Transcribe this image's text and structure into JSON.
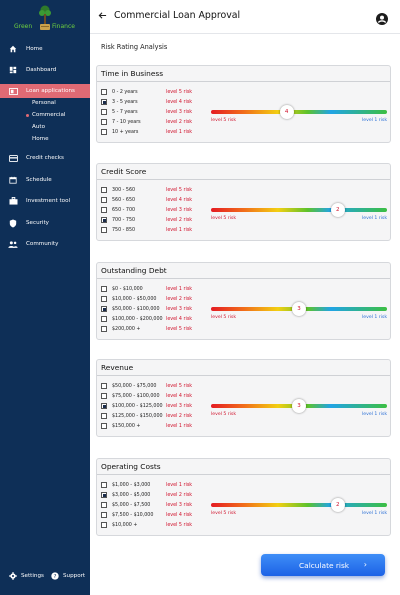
{
  "brand": {
    "word_left": "Green",
    "word_right": "Finance"
  },
  "sidebar": {
    "items": [
      {
        "label": "Home",
        "icon": "home-icon"
      },
      {
        "label": "Dashboard",
        "icon": "dashboard-icon"
      },
      {
        "label": "Loan applications",
        "icon": "card-icon",
        "active": true
      },
      {
        "label": "Credit checks",
        "icon": "credit-card-icon"
      },
      {
        "label": "Schedule",
        "icon": "calendar-icon"
      },
      {
        "label": "Investment tool",
        "icon": "briefcase-icon"
      },
      {
        "label": "Security",
        "icon": "shield-icon"
      },
      {
        "label": "Community",
        "icon": "people-icon"
      }
    ],
    "sub_items": [
      {
        "label": "Personal"
      },
      {
        "label": "Commercial",
        "active": true
      },
      {
        "label": "Auto"
      },
      {
        "label": "Home"
      }
    ],
    "footer": {
      "settings": "Settings",
      "support": "Support"
    }
  },
  "header": {
    "title": "Commercial Loan Approval"
  },
  "section": {
    "title": "Risk Rating Analysis"
  },
  "colors": {
    "accent": "#1c62e6",
    "sidebar": "#0e2f57",
    "active": "#e06a74",
    "risk_text": "#d0112b"
  },
  "criteria": [
    {
      "title": "Time in Business",
      "options": [
        {
          "label": "0 - 2 years",
          "risk": "level 5 risk",
          "checked": false
        },
        {
          "label": "3 - 5 years",
          "risk": "level 4 risk",
          "checked": true
        },
        {
          "label": "5 - 7 years",
          "risk": "level 3 risk",
          "checked": false
        },
        {
          "label": "7 - 10 years",
          "risk": "level 2 risk",
          "checked": false
        },
        {
          "label": "10 + years",
          "risk": "level 1 risk",
          "checked": false
        }
      ],
      "slider": {
        "value": 4,
        "position": 0.43,
        "low": "level 5 risk",
        "high": "level 1 risk"
      }
    },
    {
      "title": "Credit Score",
      "options": [
        {
          "label": "300 - 560",
          "risk": "level 5 risk",
          "checked": false
        },
        {
          "label": "560 - 650",
          "risk": "level 4 risk",
          "checked": false
        },
        {
          "label": "650 - 700",
          "risk": "level 3 risk",
          "checked": false
        },
        {
          "label": "700 - 750",
          "risk": "level 2 risk",
          "checked": true
        },
        {
          "label": "750 - 850",
          "risk": "level 1 risk",
          "checked": false
        }
      ],
      "slider": {
        "value": 2,
        "position": 0.72,
        "low": "level 5 risk",
        "high": "level 1 risk"
      }
    },
    {
      "title": "Outstanding Debt",
      "options": [
        {
          "label": "$0 - $10,000",
          "risk": "level 1 risk",
          "checked": false
        },
        {
          "label": "$10,000 - $50,000",
          "risk": "level 2 risk",
          "checked": false
        },
        {
          "label": "$50,000 - $100,000",
          "risk": "level 3 risk",
          "checked": true
        },
        {
          "label": "$100,000 - $200,000",
          "risk": "level 4 risk",
          "checked": false
        },
        {
          "label": "$200,000 +",
          "risk": "level 5 risk",
          "checked": false
        }
      ],
      "slider": {
        "value": 3,
        "position": 0.5,
        "low": "level 5 risk",
        "high": "level 1 risk"
      }
    },
    {
      "title": "Revenue",
      "options": [
        {
          "label": "$50,000 - $75,000",
          "risk": "level 5 risk",
          "checked": false
        },
        {
          "label": "$75,000 - $100,000",
          "risk": "level 4 risk",
          "checked": false
        },
        {
          "label": "$100,000 - $125,000",
          "risk": "level 3 risk",
          "checked": true
        },
        {
          "label": "$125,000 - $150,000",
          "risk": "level 2 risk",
          "checked": false
        },
        {
          "label": "$150,000 +",
          "risk": "level 1 risk",
          "checked": false
        }
      ],
      "slider": {
        "value": 3,
        "position": 0.5,
        "low": "level 5 risk",
        "high": "level 1 risk"
      }
    },
    {
      "title": "Operating Costs",
      "options": [
        {
          "label": "$1,000 - $3,000",
          "risk": "level 1 risk",
          "checked": false
        },
        {
          "label": "$3,000 - $5,000",
          "risk": "level 2 risk",
          "checked": true
        },
        {
          "label": "$5,000 - $7,500",
          "risk": "level 3 risk",
          "checked": false
        },
        {
          "label": "$7,500 - $10,000",
          "risk": "level 4 risk",
          "checked": false
        },
        {
          "label": "$10,000 +",
          "risk": "level 5 risk",
          "checked": false
        }
      ],
      "slider": {
        "value": 2,
        "position": 0.72,
        "low": "level 5 risk",
        "high": "level 1 risk"
      }
    }
  ],
  "actions": {
    "calculate": "Calculate risk",
    "calculate_arrow": "›"
  }
}
